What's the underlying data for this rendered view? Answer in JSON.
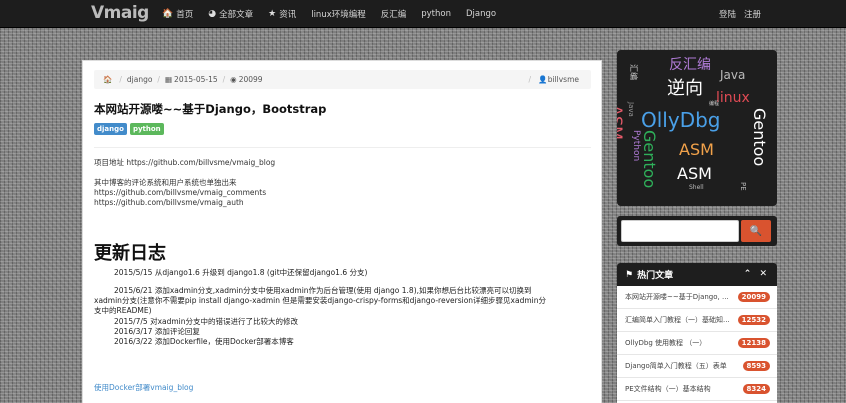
{
  "navbar": {
    "brand": "Vmaig",
    "links": [
      {
        "icon": "home-icon",
        "glyph": "🏠",
        "label": "首页"
      },
      {
        "icon": "globe-icon",
        "glyph": "◕",
        "label": "全部文章"
      },
      {
        "icon": "star-icon",
        "glyph": "★",
        "label": "资讯"
      },
      {
        "icon": "",
        "glyph": "",
        "label": "linux环境编程"
      },
      {
        "icon": "",
        "glyph": "",
        "label": "反汇编"
      },
      {
        "icon": "",
        "glyph": "",
        "label": "python"
      },
      {
        "icon": "",
        "glyph": "",
        "label": "Django"
      }
    ],
    "login": "登陆",
    "register": "注册"
  },
  "post": {
    "breadcrumb": {
      "category": "django",
      "date": "2015-05-15",
      "views": "20099",
      "author": "billvsme"
    },
    "title": "本网站开源喽~~基于Django，Bootstrap",
    "tags": [
      "django",
      "python"
    ],
    "project_line": "项目地址 https://github.com/billvsme/vmaig_blog",
    "sub_intro": "其中博客的评论系统和用户系统也单独出来",
    "sub_links": [
      "https://github.com/billvsme/vmaig_comments",
      "https://github.com/billvsme/vmaig_auth"
    ],
    "changelog_heading": "更新日志",
    "changelog": [
      "2015/5/15 从django1.6 升级到 django1.8 (git中还保留django1.6 分支)",
      "2015/6/21 添加xadmin分支,xadmin分支中使用xadmin作为后台管理(使用 django 1.8),如果你想后台比较漂亮可以切换到",
      "xadmin分支(注意你不需要pip install django-xadmin 但是需要安装django-crispy-forms和django-reversion详细步骤见xadmin分",
      "支中的README)",
      "2015/7/5 对xadmin分支中的错误进行了比较大的修改",
      "2016/3/17 添加评论回复",
      "2016/3/22 添加Dockerfile，使用Docker部署本博客"
    ],
    "docker_link": "使用Docker部署vmaig_blog"
  },
  "wordcloud": {
    "words": [
      {
        "text": "反汇编",
        "color": "#b07bd6"
      },
      {
        "text": "Java",
        "color": "#bbbbbb"
      },
      {
        "text": "ASM",
        "color": "#e65a6a"
      },
      {
        "text": "逆向",
        "color": "#ffffff"
      },
      {
        "text": "linux",
        "color": "#e04a54"
      },
      {
        "text": "Gentoo",
        "color": "#ffffff"
      },
      {
        "text": "OllyDbg",
        "color": "#4aa0e8"
      },
      {
        "text": "Gentoo",
        "color": "#2fb05a"
      },
      {
        "text": "ASM",
        "color": "#f2a24a"
      },
      {
        "text": "ASM",
        "color": "#ffffff"
      },
      {
        "text": "Python",
        "color": "#b07bd6"
      },
      {
        "text": "Java",
        "color": "#999999"
      },
      {
        "text": "PE",
        "color": "#bbbbbb"
      },
      {
        "text": "汇编",
        "color": "#cccccc"
      },
      {
        "text": "Shell",
        "color": "#bbbbbb"
      },
      {
        "text": "编程",
        "color": "#cccccc"
      }
    ]
  },
  "sidebar": {
    "search_placeholder": "",
    "hot_title": "热门文章",
    "hot_items": [
      {
        "title": "本网站开源喽~~基于Django, ...",
        "count": "20099"
      },
      {
        "title": "汇编简单入门教程（一）基础知...",
        "count": "12532"
      },
      {
        "title": "OllyDbg 使用教程 （一）",
        "count": "12138"
      },
      {
        "title": "Django简单入门教程（五）表单",
        "count": "8593"
      },
      {
        "title": "PE文件结构（一）基本结构",
        "count": "8324"
      }
    ]
  }
}
